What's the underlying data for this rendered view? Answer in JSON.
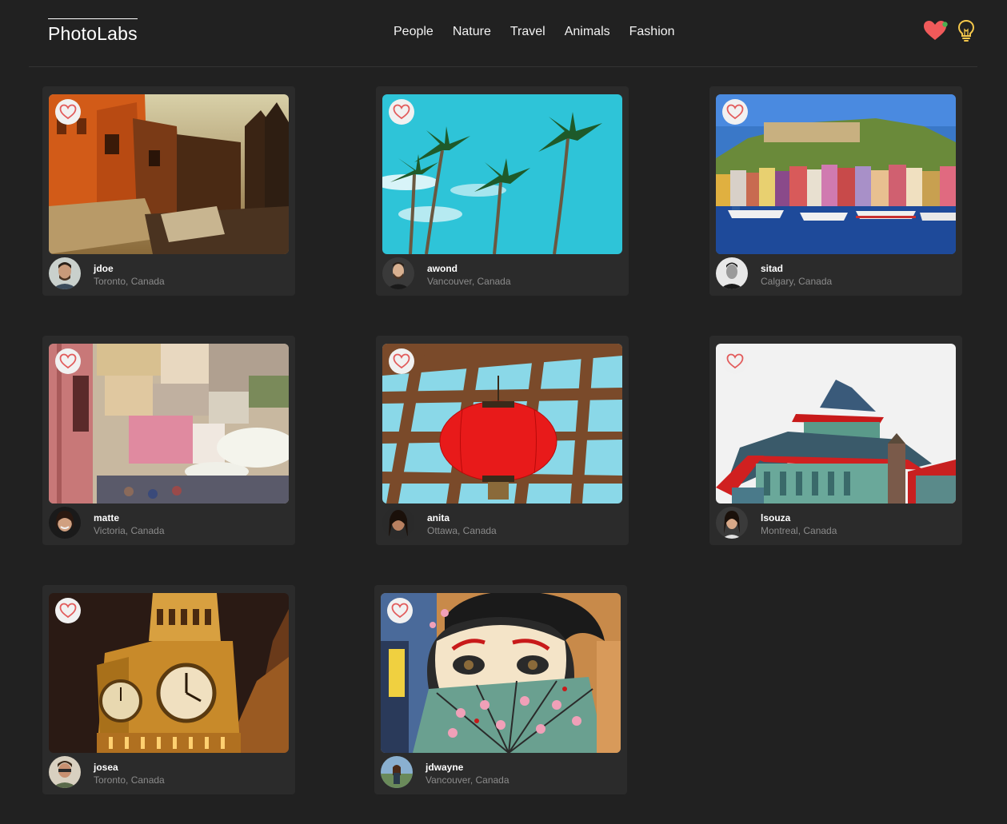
{
  "header": {
    "logo": "PhotoLabs",
    "topics": [
      "People",
      "Nature",
      "Travel",
      "Animals",
      "Fashion"
    ],
    "icons": {
      "favourites": "heart-icon",
      "notification": "green-dot",
      "theme": "lightbulb-icon"
    },
    "colors": {
      "heart": "#f05a5a",
      "notify": "#4caf50",
      "bulb": "#f5c84b",
      "background": "#212121",
      "card": "#2b2b2b"
    }
  },
  "photos": [
    {
      "username": "jdoe",
      "location": "Toronto, Canada"
    },
    {
      "username": "awond",
      "location": "Vancouver, Canada"
    },
    {
      "username": "sitad",
      "location": "Calgary, Canada"
    },
    {
      "username": "matte",
      "location": "Victoria, Canada"
    },
    {
      "username": "anita",
      "location": "Ottawa, Canada"
    },
    {
      "username": "lsouza",
      "location": "Montreal, Canada"
    },
    {
      "username": "josea",
      "location": "Toronto, Canada"
    },
    {
      "username": "jdwayne",
      "location": "Vancouver, Canada"
    }
  ]
}
